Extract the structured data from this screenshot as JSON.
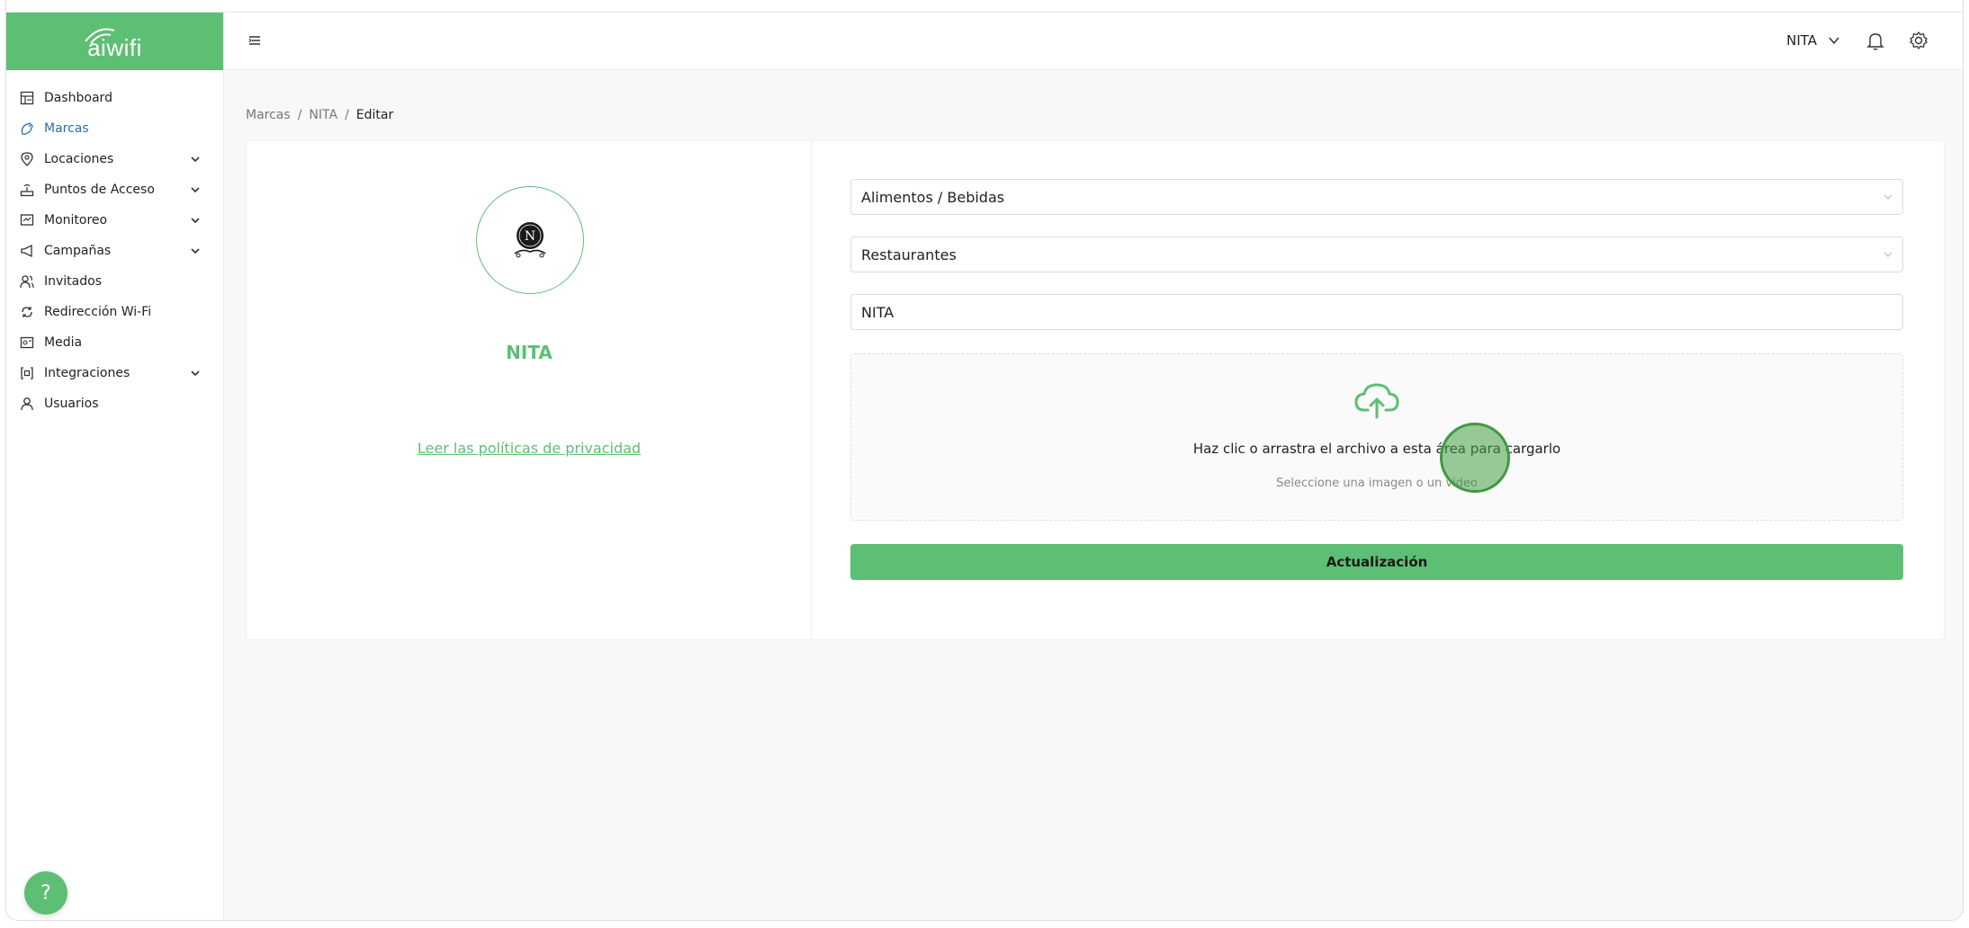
{
  "brand": {
    "logo_text": "aiwifi",
    "accent": "#5dbf74"
  },
  "sidebar": {
    "items": [
      {
        "label": "Dashboard",
        "icon": "dashboard-icon",
        "active": false,
        "expandable": false
      },
      {
        "label": "Marcas",
        "icon": "brand-icon",
        "active": true,
        "expandable": false
      },
      {
        "label": "Locaciones",
        "icon": "location-pin-icon",
        "active": false,
        "expandable": true
      },
      {
        "label": "Puntos de Acceso",
        "icon": "router-icon",
        "active": false,
        "expandable": true
      },
      {
        "label": "Monitoreo",
        "icon": "monitor-icon",
        "active": false,
        "expandable": true
      },
      {
        "label": "Campañas",
        "icon": "megaphone-icon",
        "active": false,
        "expandable": true
      },
      {
        "label": "Invitados",
        "icon": "users-icon",
        "active": false,
        "expandable": false
      },
      {
        "label": "Redirección Wi-Fi",
        "icon": "redirect-icon",
        "active": false,
        "expandable": false
      },
      {
        "label": "Media",
        "icon": "media-icon",
        "active": false,
        "expandable": false
      },
      {
        "label": "Integraciones",
        "icon": "integrations-icon",
        "active": false,
        "expandable": true
      },
      {
        "label": "Usuarios",
        "icon": "user-icon",
        "active": false,
        "expandable": false
      }
    ],
    "help_label": "?"
  },
  "header": {
    "user_name": "NITA"
  },
  "breadcrumb": {
    "items": [
      "Marcas",
      "NITA"
    ],
    "sep": "/",
    "current": "Editar"
  },
  "profile": {
    "avatar_letter": "N",
    "name": "NITA",
    "privacy_link": "Leer las políticas de privacidad"
  },
  "form": {
    "category": "Alimentos / Bebidas",
    "subcategory": "Restaurantes",
    "name_value": "NITA",
    "upload_title": "Haz clic o arrastra el archivo a esta área para cargarlo",
    "upload_hint": "Seleccione una imagen o un video",
    "submit_label": "Actualización"
  }
}
